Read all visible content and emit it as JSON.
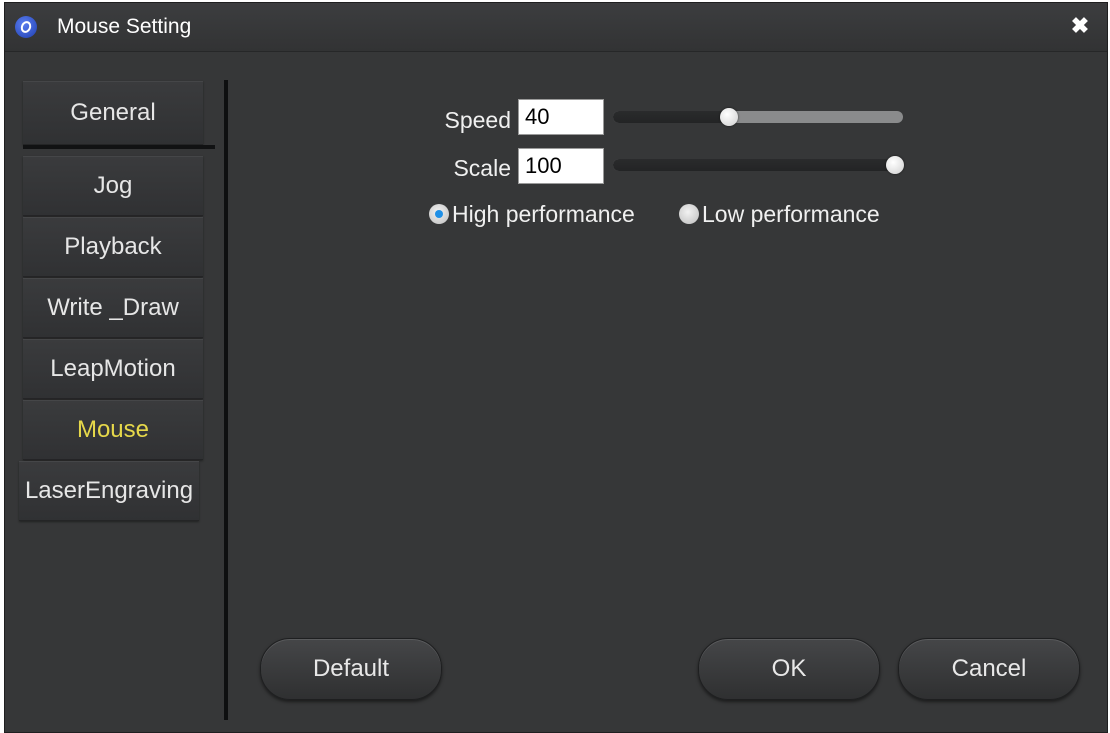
{
  "window": {
    "title": "Mouse Setting",
    "icon": "app-logo-icon",
    "close_icon": "close-icon",
    "close_glyph": "✖"
  },
  "sidebar": {
    "tabs": [
      {
        "label": "General"
      },
      {
        "label": "Jog"
      },
      {
        "label": "Playback"
      },
      {
        "label": "Write _Draw"
      },
      {
        "label": "LeapMotion"
      },
      {
        "label": "Mouse",
        "active": true
      },
      {
        "label": "LaserEngraving"
      }
    ]
  },
  "settings": {
    "speed": {
      "label": "Speed",
      "value": "40",
      "slider_fraction": 0.4
    },
    "scale": {
      "label": "Scale",
      "value": "100",
      "slider_fraction": 1.0
    },
    "performance": {
      "options": [
        {
          "label": "High performance",
          "selected": true
        },
        {
          "label": "Low performance",
          "selected": false
        }
      ]
    }
  },
  "buttons": {
    "default": "Default",
    "ok": "OK",
    "cancel": "Cancel"
  },
  "colors": {
    "active_tab_text": "#e6d84a",
    "radio_selected": "#1e8fe6",
    "background": "#363738"
  }
}
